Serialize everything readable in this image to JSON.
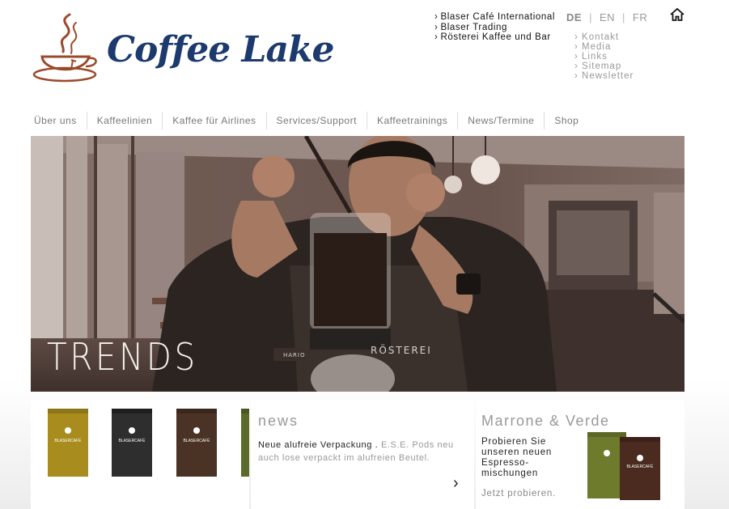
{
  "brand": {
    "name": "Coffee Lake"
  },
  "top_links": [
    "Blaser Café International",
    "Blaser Trading",
    "Rösterei Kaffee und Bar"
  ],
  "languages": {
    "active": "DE",
    "en": "EN",
    "fr": "FR",
    "sep": "|"
  },
  "util_links": [
    "Kontakt",
    "Media",
    "Links",
    "Sitemap",
    "Newsletter"
  ],
  "nav": [
    "Über uns",
    "Kaffeelinien",
    "Kaffee für Airlines",
    "Services/Support",
    "Kaffeetrainings",
    "News/Termine",
    "Shop"
  ],
  "hero": {
    "title": "TRENDS",
    "apron_text": "RÖSTEREI",
    "brand_mark": "HARIO"
  },
  "products": {
    "bag_label": "BLASERCAFÉ",
    "bag_colors": [
      "#a88d1e",
      "#2e2e2e",
      "#4a3324",
      "#5a6a2a"
    ]
  },
  "news": {
    "title": "news",
    "lead": "Neue alufreie Verpackung .",
    "body": "E.S.E. Pods neu auch lose verpackt im alufreien Beutel.",
    "arrow": "›"
  },
  "promo": {
    "title": "Marrone & Verde",
    "text": "Probieren Sie unseren neuen Espresso-mischungen",
    "link": "Jetzt probieren.",
    "bag_colors": [
      "#6e7a2c",
      "#4b2a1f"
    ]
  },
  "colors": {
    "brand_blue": "#1d3a6e",
    "brand_brown": "#9a4a2a",
    "nav_text": "#777777"
  }
}
